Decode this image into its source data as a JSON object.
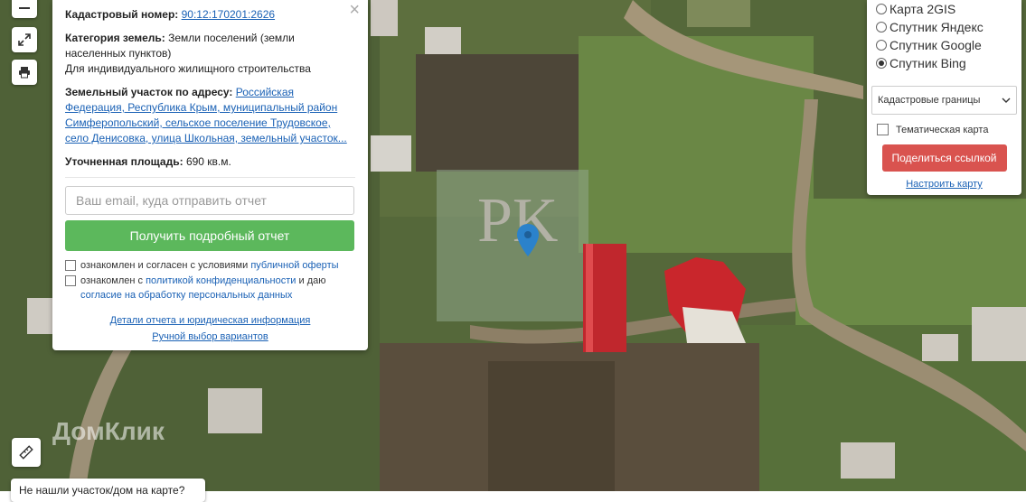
{
  "popup": {
    "cadastral_label": "Кадастровый номер:",
    "cadastral_value": "90:12:170201:2626",
    "category_label": "Категория земель:",
    "category_value": "Земли поселений (земли населенных пунктов)",
    "use": "Для индивидуального жилищного строительства",
    "address_label": "Земельный участок по адресу:",
    "address_value": "Российская Федерация, Республика Крым, муниципальный район Симферопольский, сельское поселение Трудовское, село Денисовка, улица Школьная, земельный участок...",
    "area_label": "Уточненная площадь:",
    "area_value": "690 кв.м.",
    "email_placeholder": "Ваш email, куда отправить отчет",
    "report_button": "Получить подробный отчет",
    "consent1_text": "ознакомлен и согласен с условиями",
    "consent1_link": "публичной оферты",
    "consent2_text": "ознакомлен с",
    "consent2_link1": "политикой конфиденциальности",
    "consent2_mid": "и даю",
    "consent2_link2": "согласие на обработку персональных данных",
    "details_link": "Детали отчета и юридическая информация",
    "manual_link": "Ручной выбор вариантов",
    "close": "×"
  },
  "layers": {
    "options": [
      {
        "label": "Карта 2GIS",
        "selected": false
      },
      {
        "label": "Спутник Яндекс",
        "selected": false
      },
      {
        "label": "Спутник Google",
        "selected": false
      },
      {
        "label": "Спутник Bing",
        "selected": true
      }
    ],
    "select_value": "Кадастровые границы",
    "thematic": "Тематическая карта",
    "share_button": "Поделиться ссылкой",
    "tune_link": "Настроить карту"
  },
  "map": {
    "watermark": "ДомКлик",
    "not_found": "Не нашли участок/дом на карте?",
    "parcel_logo": "PK"
  },
  "colors": {
    "green_button": "#5cb85c",
    "red_button": "#d9534f",
    "link": "#1a61b5",
    "marker": "#2b82cb"
  }
}
